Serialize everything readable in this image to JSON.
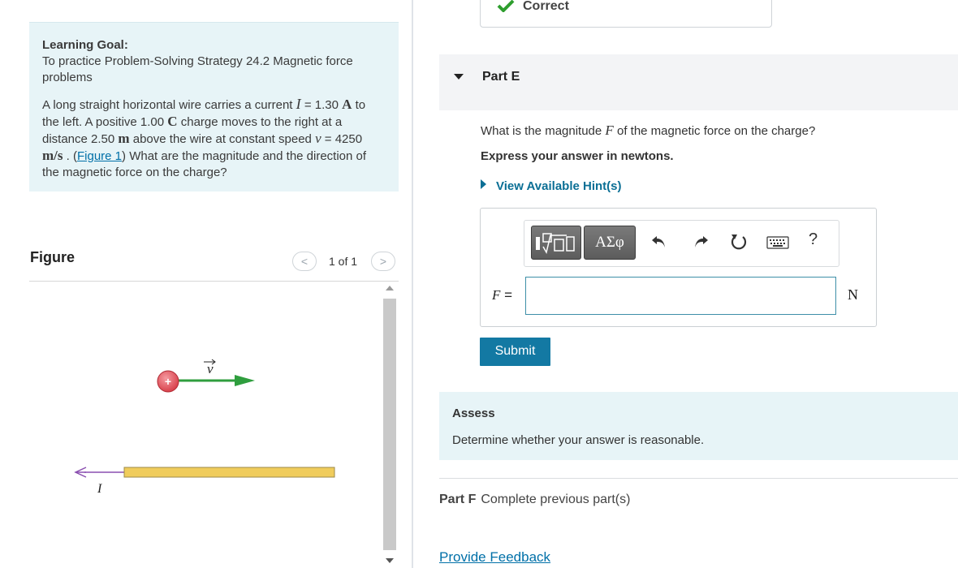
{
  "goal": {
    "title": "Learning Goal:",
    "subtitle": "To practice Problem-Solving Strategy 24.2 Magnetic force problems",
    "problem": {
      "t1": "A long straight horizontal wire carries a current ",
      "sym_I": "I",
      "t2": " = 1.30 ",
      "unit_A": "A",
      "t3": " to the left. A positive 1.00 ",
      "unit_C": "C",
      "t4": " charge moves to the right at a distance 2.50 ",
      "unit_m": "m",
      "t5": " above the wire at constant speed ",
      "sym_v": "v",
      "t6": " = 4250 ",
      "unit_ms": "m/s",
      "t7": " . (",
      "figure_link": "Figure 1",
      "t8": ") What are the magnitude and the direction of the magnetic force on the charge?"
    }
  },
  "figure_panel": {
    "title": "Figure",
    "pager": "1 of 1",
    "prev_glyph": "<",
    "next_glyph": ">",
    "charge_sign": "+",
    "velocity_label": "v",
    "current_label": "I",
    "colors": {
      "charge": "#e2505a",
      "velocity_arrow": "#2f9e3e",
      "wire": "#f0cc5c",
      "current_arrow": "#8a4fb0"
    }
  },
  "status": {
    "text": "Correct",
    "color": "#2e9e2e"
  },
  "part_e": {
    "title": "Part E",
    "question_prefix": "What is the magnitude ",
    "question_symbol": "F",
    "question_suffix": " of the magnetic force on the charge?",
    "instruction": "Express your answer in newtons.",
    "hint": "View Available Hint(s)",
    "toolbar": {
      "symbols": "ΑΣφ",
      "help": "?"
    },
    "answer_label": "F",
    "answer_equals": " =",
    "answer_value": "",
    "unit": "N",
    "submit": "Submit"
  },
  "assess": {
    "title": "Assess",
    "text": "Determine whether your answer is reasonable."
  },
  "part_f": {
    "label": "Part F",
    "status": "Complete previous part(s)"
  },
  "feedback": "Provide Feedback"
}
